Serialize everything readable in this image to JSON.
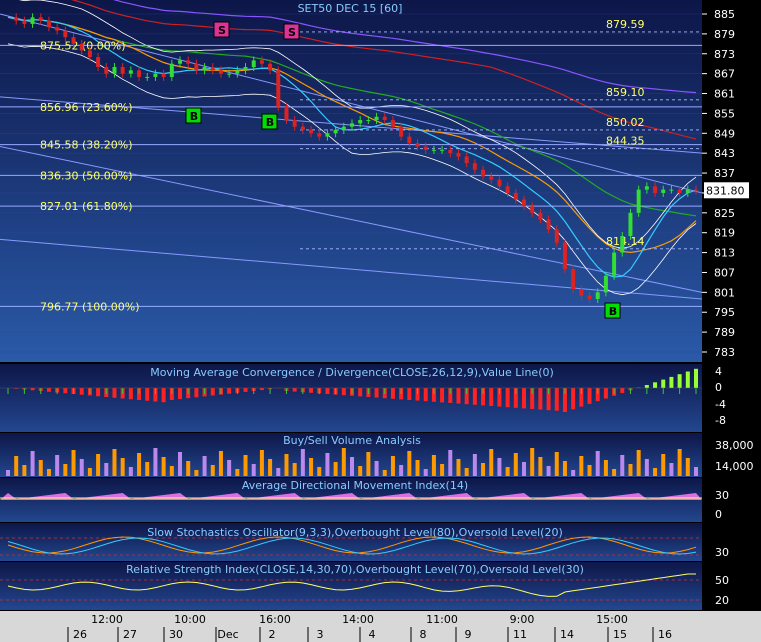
{
  "title": "SET50 DEC 15  [60]",
  "colors": {
    "panel_bg_top": "#101a55",
    "panel_bg_bottom": "#2a5aa8",
    "grid": "#3a5fb0",
    "fib_label": "#ffff66",
    "price_label": "#ffff66",
    "axis_text": "#ffffff",
    "bull": "#33dd33",
    "bear": "#dd2222",
    "buy_badge": "#00dd00",
    "sell_badge": "#dd3399",
    "last_price_bg": "#ffffff"
  },
  "price_axis": {
    "ticks": [
      "885",
      "879",
      "873",
      "867",
      "861",
      "855",
      "849",
      "843",
      "837",
      "831",
      "825",
      "819",
      "813",
      "807",
      "801",
      "795",
      "789",
      "783"
    ],
    "last_price": "831.80"
  },
  "fib_levels": [
    {
      "label": "875.52 (0.00%)",
      "value": 875.52
    },
    {
      "label": "856.96 (23.60%)",
      "value": 856.96
    },
    {
      "label": "845.58 (38.20%)",
      "value": 845.58
    },
    {
      "label": "836.30 (50.00%)",
      "value": 836.3
    },
    {
      "label": "827.01 (61.80%)",
      "value": 827.01
    },
    {
      "label": "796.77 (100.00%)",
      "value": 796.77
    }
  ],
  "price_annotations": [
    {
      "label": "879.59",
      "value": 879.59
    },
    {
      "label": "859.10",
      "value": 859.1
    },
    {
      "label": "850.02",
      "value": 850.02
    },
    {
      "label": "844.35",
      "value": 844.35
    },
    {
      "label": "814.14",
      "value": 814.14
    }
  ],
  "signals": [
    {
      "type": "sell",
      "label": "S"
    },
    {
      "type": "sell",
      "label": "S"
    },
    {
      "type": "buy",
      "label": "B"
    },
    {
      "type": "buy",
      "label": "B"
    },
    {
      "type": "buy",
      "label": "B"
    }
  ],
  "panels": {
    "macd": {
      "title": "Moving Average Convergence / Divergence(CLOSE,26,12,9),Value Line(0)",
      "ticks": [
        "4",
        "0",
        "-4",
        "-8"
      ]
    },
    "volume": {
      "title": "Buy/Sell Volume Analysis",
      "ticks": [
        "38,000",
        "14,000"
      ]
    },
    "adx": {
      "title": "Average Directional Movement Index(14)",
      "ticks": [
        "30",
        "0"
      ]
    },
    "stoch": {
      "title": "Slow Stochastics Oscillator(9,3,3),Overbought Level(80),Oversold Level(20)",
      "ticks": [
        "30"
      ]
    },
    "rsi": {
      "title": "Relative Strength Index(CLOSE,14,30,70),Overbought Level(70),Oversold Level(30)",
      "ticks": [
        "50",
        "20"
      ]
    }
  },
  "time_axis": {
    "times": [
      "12:00",
      "10:00",
      "16:00",
      "14:00",
      "11:00",
      "9:00",
      "15:00"
    ],
    "dates": [
      "26",
      "27",
      "30",
      "Dec",
      "2",
      "3",
      "4",
      "8",
      "9",
      "11",
      "14",
      "15",
      "16"
    ]
  },
  "chart_data": {
    "type": "candlestick",
    "title": "SET50 DEC 15  [60]",
    "ylim": [
      781,
      887
    ],
    "y_ticks": [
      885,
      879,
      873,
      867,
      861,
      855,
      849,
      843,
      837,
      831,
      825,
      819,
      813,
      807,
      801,
      795,
      789,
      783
    ],
    "close": [
      884,
      883,
      882,
      884,
      883,
      881,
      880,
      878,
      876,
      874,
      872,
      869,
      867,
      869,
      867,
      868,
      866,
      866,
      867,
      866,
      870,
      871,
      870,
      868,
      869,
      868,
      867,
      867,
      868,
      869,
      871,
      870,
      868,
      857,
      853,
      851,
      850,
      849,
      848,
      849,
      850,
      851,
      852,
      853,
      853,
      854,
      853,
      851,
      848,
      846,
      845,
      844,
      844,
      844,
      843,
      842,
      840,
      838,
      836,
      835,
      833,
      831,
      829,
      827,
      825,
      823,
      820,
      816,
      808,
      802,
      800,
      799,
      801,
      806,
      813,
      818,
      825,
      832,
      833,
      831,
      832,
      832,
      831,
      832,
      831.8
    ],
    "buy_sell_signals": [
      "S",
      "S",
      "B",
      "B",
      "B"
    ],
    "last_price": 831.8
  }
}
